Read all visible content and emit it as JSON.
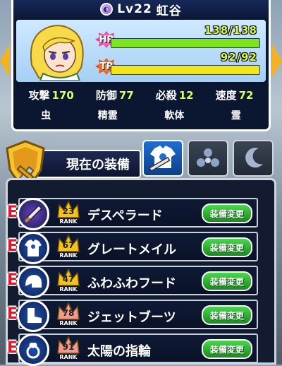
{
  "character": {
    "level_label": "Lv22",
    "name": "虹谷"
  },
  "gauges": {
    "hp": {
      "label": "HP",
      "text": "138/138",
      "current": 138,
      "max": 138,
      "color": "#7fe41e"
    },
    "tp": {
      "label": "TP",
      "text": "92/92",
      "current": 92,
      "max": 92,
      "color": "#f2e61a"
    }
  },
  "stats": [
    {
      "label": "攻撃",
      "value": "170"
    },
    {
      "label": "防御",
      "value": "77"
    },
    {
      "label": "必殺",
      "value": "12"
    },
    {
      "label": "速度",
      "value": "72"
    }
  ],
  "traits": [
    "虫",
    "精霊",
    "軟体",
    "霊"
  ],
  "equipment_header": {
    "title": "現在の装備"
  },
  "tabs": [
    {
      "icon": "armor-weapon-icon",
      "active": true
    },
    {
      "icon": "gem-cluster-icon",
      "active": false
    },
    {
      "icon": "moon-orb-icon",
      "active": false
    }
  ],
  "slots": [
    {
      "type_mark": "E",
      "icon": "sword-icon",
      "icon_color": "#6a3fbf",
      "rank": "23",
      "rank_label": "RANK",
      "crown_color": "#f5c21c",
      "name": "デスペラード",
      "button": "装備変更"
    },
    {
      "type_mark": "E",
      "icon": "shirt-icon",
      "icon_color": "#1f4fb0",
      "rank": "67",
      "rank_label": "RANK",
      "crown_color": "#f5c21c",
      "name": "グレートメイル",
      "button": "装備変更"
    },
    {
      "type_mark": "E",
      "icon": "helmet-icon",
      "icon_color": "#1f4fb0",
      "rank": "47",
      "rank_label": "RANK",
      "crown_color": "#f5c21c",
      "name": "ふわふわフード",
      "button": "装備変更"
    },
    {
      "type_mark": "E",
      "icon": "boots-icon",
      "icon_color": "#1f4fb0",
      "rank": "78",
      "rank_label": "RANK",
      "crown_color": "#f09a8e",
      "name": "ジェットブーツ",
      "button": "装備変更"
    },
    {
      "type_mark": "E",
      "icon": "ring-icon",
      "icon_color": "#1f4fb0",
      "rank": "91",
      "rank_label": "RANK",
      "crown_color": "#f09a8e",
      "name": "太陽の指輪",
      "button": "装備変更"
    }
  ]
}
